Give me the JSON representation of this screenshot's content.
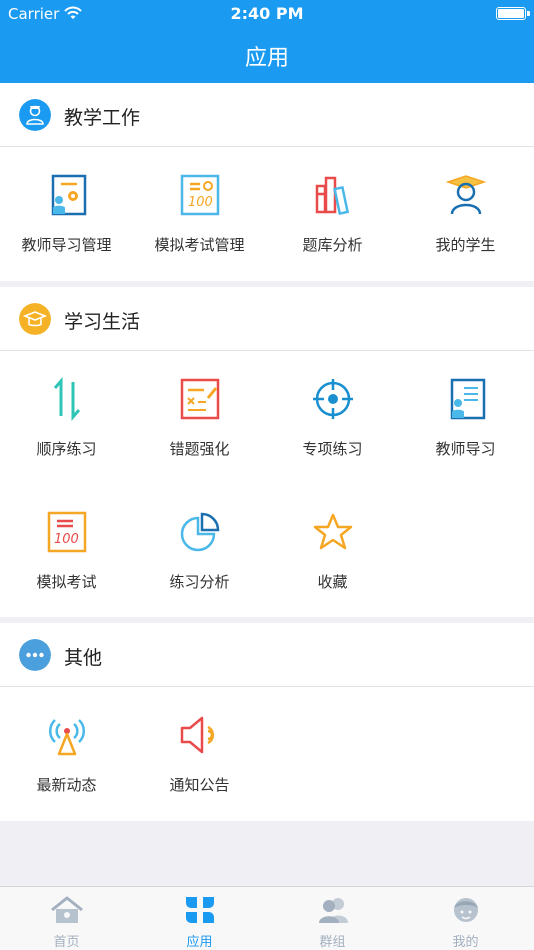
{
  "status_bar": {
    "carrier": "Carrier",
    "time": "2:40 PM"
  },
  "nav": {
    "title": "应用"
  },
  "sections": [
    {
      "title": "教学工作",
      "icon": "teacher-avatar-icon",
      "items": [
        {
          "label": "教师导习管理",
          "icon": "teacher-guide-manage-icon"
        },
        {
          "label": "模拟考试管理",
          "icon": "mock-exam-manage-icon"
        },
        {
          "label": "题库分析",
          "icon": "question-bank-icon"
        },
        {
          "label": "我的学生",
          "icon": "graduate-student-icon"
        }
      ]
    },
    {
      "title": "学习生活",
      "icon": "graduation-cap-icon",
      "items": [
        {
          "label": "顺序练习",
          "icon": "sort-arrows-icon"
        },
        {
          "label": "错题强化",
          "icon": "wrong-question-icon"
        },
        {
          "label": "专项练习",
          "icon": "target-icon"
        },
        {
          "label": "教师导习",
          "icon": "teacher-guide-icon"
        },
        {
          "label": "模拟考试",
          "icon": "mock-exam-icon"
        },
        {
          "label": "练习分析",
          "icon": "pie-chart-icon"
        },
        {
          "label": "收藏",
          "icon": "star-icon"
        }
      ]
    },
    {
      "title": "其他",
      "icon": "more-dots-icon",
      "items": [
        {
          "label": "最新动态",
          "icon": "signal-tower-icon"
        },
        {
          "label": "通知公告",
          "icon": "speaker-icon"
        }
      ]
    }
  ],
  "tabs": [
    {
      "label": "首页",
      "icon": "home-icon",
      "active": false
    },
    {
      "label": "应用",
      "icon": "apps-clover-icon",
      "active": true
    },
    {
      "label": "群组",
      "icon": "group-icon",
      "active": false
    },
    {
      "label": "我的",
      "icon": "profile-face-icon",
      "active": false
    }
  ],
  "colors": {
    "accent": "#1a9af0",
    "section_icon_teaching": "#1a9af0",
    "section_icon_study": "#f5b227",
    "section_icon_other": "#4a9fdc",
    "tab_inactive": "#a3b0bf"
  }
}
